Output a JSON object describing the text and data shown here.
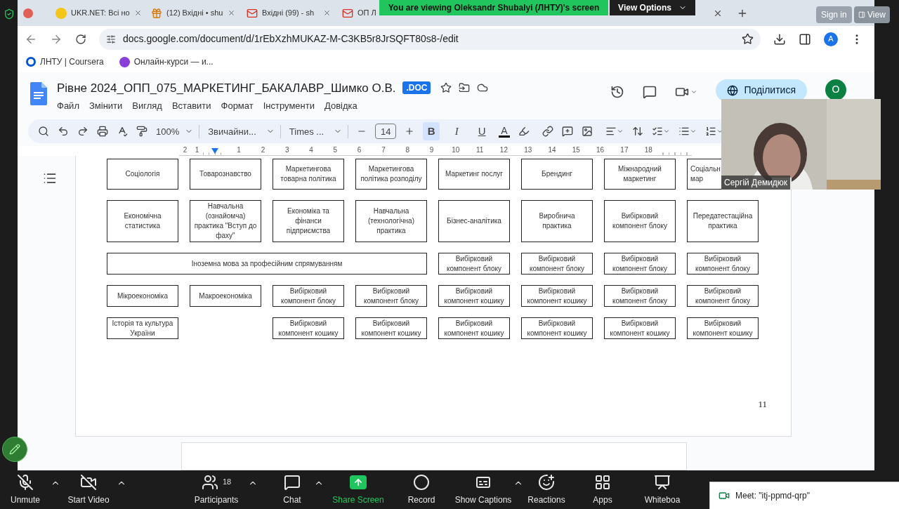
{
  "zoom": {
    "banner": "You are viewing Oleksandr Shubalyi (ЛНТУ)'s screen",
    "view_options": "View Options",
    "sign_in": "Sign in",
    "view": "View"
  },
  "browser": {
    "tabs": [
      {
        "title": "UKR.NET: Всі но",
        "kind": "ukrnet"
      },
      {
        "title": "(12) Вхідні • shu",
        "kind": "gift"
      },
      {
        "title": "Вхідні (99) - sh",
        "kind": "gmail"
      },
      {
        "title": "ОП Л",
        "kind": "gmail"
      }
    ],
    "url": "docs.google.com/document/d/1rEbXzhMUKAZ-M-C3KB5r8JrSQFT80s8-/edit",
    "avatar": "A",
    "bookmarks": [
      {
        "title": "ЛНТУ | Coursera",
        "kind": "coursera"
      },
      {
        "title": "Онлайн-курси — и...",
        "kind": "purple"
      }
    ]
  },
  "doc": {
    "title": "Рівне 2024_ОПП_075_МАРКЕТИНГ_БАКАЛАВР_Шимко О.В.",
    "badge": ".DOC",
    "menu": [
      "Файл",
      "Змінити",
      "Вигляд",
      "Вставити",
      "Формат",
      "Інструменти",
      "Довідка"
    ],
    "share": "Поділитися",
    "account": "O"
  },
  "toolbar": {
    "zoom": "100%",
    "style": "Звичайни...",
    "font": "Times ...",
    "size": "14",
    "format": [
      {
        "label": "B",
        "selected": true
      },
      {
        "label": "I",
        "selected": false
      },
      {
        "label": "U",
        "selected": false
      }
    ],
    "text_color": "A"
  },
  "ruler": [
    "2",
    "1",
    "1",
    "2",
    "3",
    "4",
    "5",
    "6",
    "7",
    "8",
    "9",
    "10",
    "11",
    "12",
    "13",
    "14",
    "15",
    "16",
    "17",
    "18"
  ],
  "grid": [
    [
      {
        "kind": "box",
        "text": "Соціологія"
      },
      {
        "kind": "box",
        "text": "Товарознавство"
      },
      {
        "kind": "box",
        "text": "Маркетингова товарна політика"
      },
      {
        "kind": "box",
        "text": "Маркетингова політика розподілу"
      },
      {
        "kind": "box",
        "text": "Маркетинг послуг"
      },
      {
        "kind": "box",
        "text": "Брендинг"
      },
      {
        "kind": "box",
        "text": "Міжнародний маркетинг"
      },
      {
        "kind": "covered",
        "text": "Соціальн мар"
      }
    ],
    [
      {
        "kind": "box",
        "text": "Економічна статистика"
      },
      {
        "kind": "box",
        "text": "Навчальна (ознайомча) практика \"Вступ до фаху\""
      },
      {
        "kind": "box",
        "text": "Економіка та фінанси підприємства"
      },
      {
        "kind": "box",
        "text": "Навчальна (технологічна) практика"
      },
      {
        "kind": "box",
        "text": "Бізнес-аналітика"
      },
      {
        "kind": "box",
        "text": "Виробнича практика"
      },
      {
        "kind": "box",
        "text": "Вибірковий компонент блоку"
      },
      {
        "kind": "box",
        "text": "Передатестаційна практика"
      }
    ],
    [
      {
        "kind": "wide",
        "text": "Іноземна мова за професійним спрямуванням"
      },
      {
        "kind": "box",
        "text": "Вибірковий компонент блоку"
      },
      {
        "kind": "box",
        "text": "Вибірковий компонент блоку"
      },
      {
        "kind": "box",
        "text": "Вибірковий компонент блоку"
      },
      {
        "kind": "box",
        "text": "Вибірковий компонент блоку"
      }
    ],
    [
      {
        "kind": "box",
        "text": "Мікроекономіка"
      },
      {
        "kind": "box",
        "text": "Макроекономіка"
      },
      {
        "kind": "box",
        "text": "Вибірковий компонент блоку"
      },
      {
        "kind": "box",
        "text": "Вибірковий компонент блоку"
      },
      {
        "kind": "box",
        "text": "Вибірковий компонент кошику"
      },
      {
        "kind": "box",
        "text": "Вибірковий компонент кошику"
      },
      {
        "kind": "box",
        "text": "Вибірковий компонент блоку"
      },
      {
        "kind": "box",
        "text": "Вибірковий компонент блоку"
      }
    ],
    [
      {
        "kind": "box",
        "text": "Історія та культура України"
      },
      {
        "kind": "blank"
      },
      {
        "kind": "box",
        "text": "Вибірковий компонент кошику"
      },
      {
        "kind": "box",
        "text": "Вибірковий компонент кошику"
      },
      {
        "kind": "box",
        "text": "Вибірковий компонент кошику"
      },
      {
        "kind": "box",
        "text": "Вибірковий компонент кошику"
      },
      {
        "kind": "box",
        "text": "Вибірковий компонент кошику"
      },
      {
        "kind": "box",
        "text": "Вибірковий компонент кошику"
      }
    ]
  ],
  "page_number": "11",
  "video": {
    "name": "Сергій Демидюк"
  },
  "controls": [
    {
      "label": "Unmute",
      "kind": "mic",
      "caret": true
    },
    {
      "label": "Start Video",
      "kind": "video",
      "caret": true
    },
    {
      "label": "Participants",
      "kind": "participants",
      "count": "18",
      "caret": true
    },
    {
      "label": "Chat",
      "kind": "chat",
      "caret": true
    },
    {
      "label": "Share Screen",
      "kind": "share",
      "caret": false
    },
    {
      "label": "Record",
      "kind": "record",
      "caret": false
    },
    {
      "label": "Show Captions",
      "kind": "captions",
      "caret": true
    },
    {
      "label": "Reactions",
      "kind": "reactions",
      "caret": false
    },
    {
      "label": "Apps",
      "kind": "apps",
      "caret": false
    },
    {
      "label": "Whiteboa",
      "kind": "whiteboard",
      "caret": false
    }
  ],
  "meet_popup": "Meet: \"itj-ppmd-qrp\""
}
